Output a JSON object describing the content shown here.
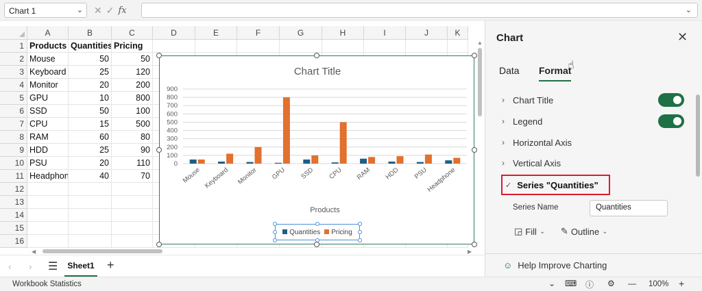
{
  "formula_bar": {
    "name_box": "Chart 1",
    "fx_label": "fx"
  },
  "grid": {
    "columns": [
      "A",
      "B",
      "C",
      "D",
      "E",
      "F",
      "G",
      "H",
      "I",
      "J",
      "K"
    ],
    "rows": [
      "1",
      "2",
      "3",
      "4",
      "5",
      "6",
      "7",
      "8",
      "9",
      "10",
      "11",
      "12",
      "13",
      "14",
      "15",
      "16"
    ],
    "headers": [
      "Products",
      "Quantities",
      "Pricing"
    ],
    "data": [
      [
        "Mouse",
        "50",
        "50"
      ],
      [
        "Keyboard",
        "25",
        "120"
      ],
      [
        "Monitor",
        "20",
        "200"
      ],
      [
        "GPU",
        "10",
        "800"
      ],
      [
        "SSD",
        "50",
        "100"
      ],
      [
        "CPU",
        "15",
        "500"
      ],
      [
        "RAM",
        "60",
        "80"
      ],
      [
        "HDD",
        "25",
        "90"
      ],
      [
        "PSU",
        "20",
        "110"
      ],
      [
        "Headphon",
        "40",
        "70"
      ]
    ]
  },
  "chart_data": {
    "type": "bar",
    "title": "Chart Title",
    "xlabel": "Products",
    "ylabel": "",
    "categories": [
      "Mouse",
      "Keyboard",
      "Monitor",
      "GPU",
      "SSD",
      "CPU",
      "RAM",
      "HDD",
      "PSU",
      "Headphone"
    ],
    "series": [
      {
        "name": "Quantities",
        "color": "#1f5f86",
        "values": [
          50,
          25,
          20,
          10,
          50,
          15,
          60,
          25,
          20,
          40
        ]
      },
      {
        "name": "Pricing",
        "color": "#e2702e",
        "values": [
          50,
          120,
          200,
          800,
          100,
          500,
          80,
          90,
          110,
          70
        ]
      }
    ],
    "ylim": [
      0,
      900
    ],
    "yticks": [
      0,
      100,
      200,
      300,
      400,
      500,
      600,
      700,
      800,
      900
    ],
    "grid": true,
    "legend": "bottom"
  },
  "sheet_tabs": {
    "active": "Sheet1",
    "add_label": "+"
  },
  "status_bar": {
    "left_text": "Workbook Statistics",
    "zoom": "100%"
  },
  "panel": {
    "title": "Chart",
    "tabs": [
      "Data",
      "Format"
    ],
    "sections": [
      {
        "label": "Chart Title",
        "toggle": true
      },
      {
        "label": "Legend",
        "toggle": true
      },
      {
        "label": "Horizontal Axis"
      },
      {
        "label": "Vertical Axis"
      }
    ],
    "series_section": "Series \"Quantities\"",
    "series_name_label": "Series Name",
    "series_name_value": "Quantities",
    "fill_label": "Fill",
    "outline_label": "Outline",
    "footer": "Help Improve Charting"
  },
  "colors": {
    "accent": "#1e7145",
    "highlight": "#e0192d"
  }
}
